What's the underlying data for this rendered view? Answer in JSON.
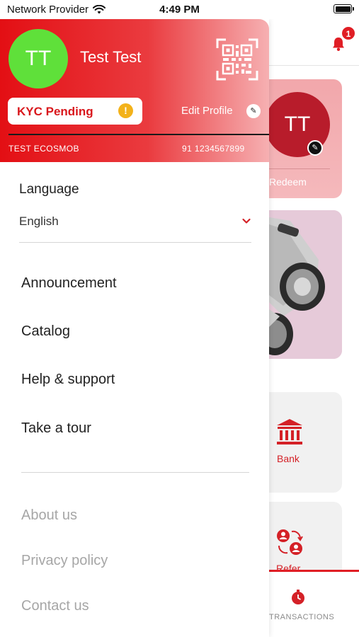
{
  "status_bar": {
    "carrier": "Network Provider",
    "time": "4:49 PM",
    "icons": [
      "wifi-icon",
      "battery-icon"
    ]
  },
  "background": {
    "notification_count": "1",
    "profile_card": {
      "avatar_initials": "TT",
      "redeem_label": "Redeem"
    },
    "bank_label": "Bank",
    "refer_label": "Refer",
    "tab_label": "TRANSACTIONS"
  },
  "drawer": {
    "header": {
      "avatar_initials": "TT",
      "user_name": "Test Test",
      "kyc_status": "KYC Pending",
      "kyc_warning": "!",
      "edit_profile_label": "Edit Profile",
      "company_name": "TEST ECOSMOB",
      "phone": "91 1234567899"
    },
    "language": {
      "label": "Language",
      "value": "English"
    },
    "menu": [
      {
        "label": "Announcement"
      },
      {
        "label": "Catalog"
      },
      {
        "label": "Help & support"
      },
      {
        "label": "Take a tour"
      }
    ],
    "info_links": [
      {
        "label": "About us"
      },
      {
        "label": "Privacy policy"
      },
      {
        "label": "Contact us"
      }
    ]
  },
  "colors": {
    "brand_red": "#e30f14",
    "avatar_green": "#5fe03a",
    "warning_yellow": "#f3b21a",
    "muted_text": "#a6a6a6"
  }
}
